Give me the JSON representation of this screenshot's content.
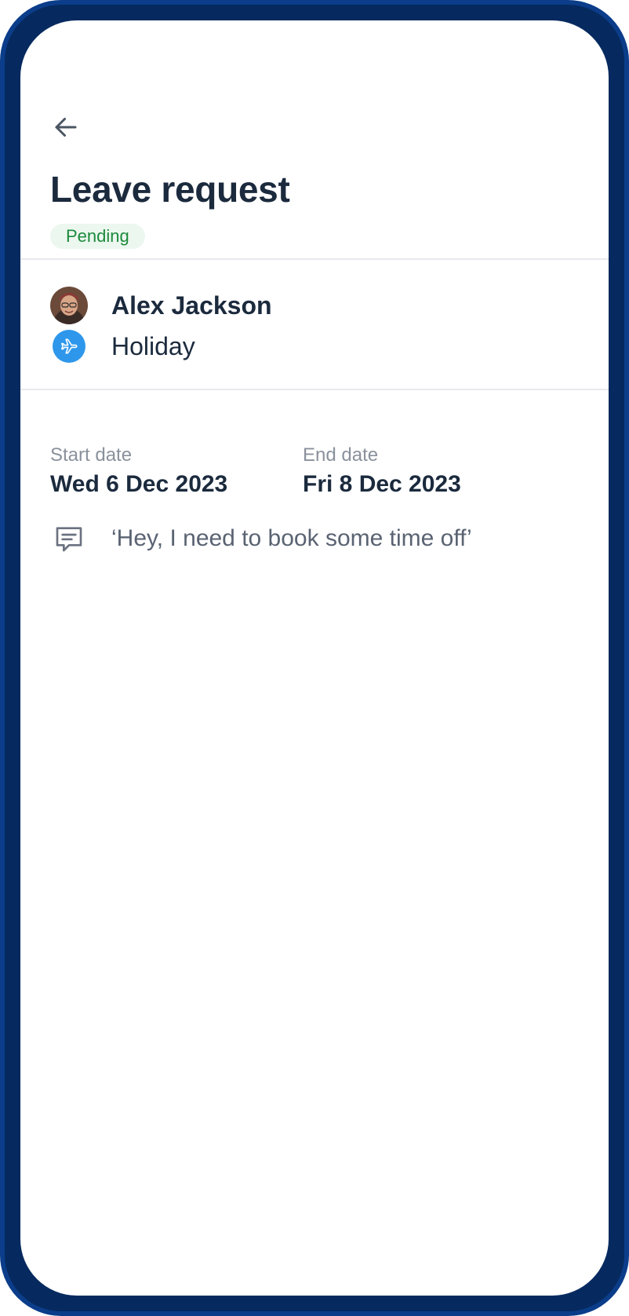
{
  "header": {
    "title": "Leave request",
    "status": "Pending"
  },
  "employee": {
    "name": "Alex Jackson",
    "leave_type": "Holiday"
  },
  "dates": {
    "start_label": "Start date",
    "start_value": "Wed 6 Dec 2023",
    "end_label": "End date",
    "end_value": "Fri 8 Dec 2023"
  },
  "note": {
    "text": "‘Hey, I need to book some time off’"
  },
  "icons": {
    "back": "arrow-left-icon",
    "leave_type": "airplane-icon",
    "note": "comment-icon"
  },
  "colors": {
    "frame": "#062a5f",
    "status_text": "#1c8a3c",
    "status_bg": "#ecf7ef",
    "leave_type_icon_bg": "#2e97eb",
    "heading_text": "#1b2a3d"
  }
}
